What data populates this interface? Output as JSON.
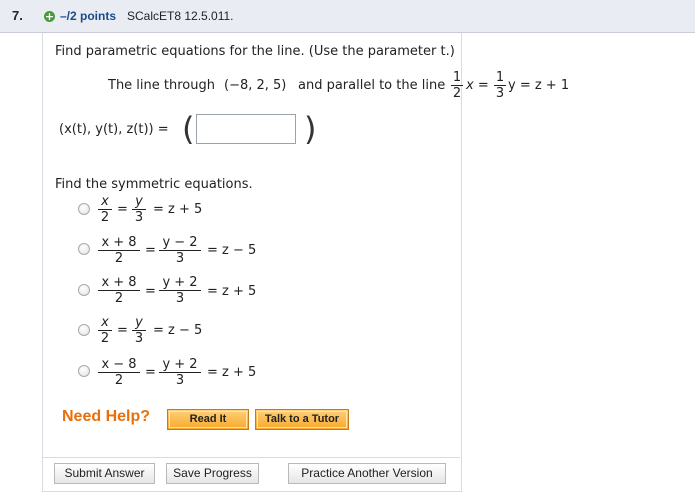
{
  "header": {
    "question_number": "7.",
    "points": "–/2 points",
    "question_id": "SCalcET8 12.5.011."
  },
  "prompt": {
    "instruction": "Find parametric equations for the line. (Use the parameter t.)",
    "line_prefix": "The line through",
    "point": "(−8, 2, 5)",
    "parallel_text": "and parallel to the line",
    "eq_frac1_num": "1",
    "eq_frac1_den": "2",
    "eq_x": "x =",
    "eq_frac2_num": "1",
    "eq_frac2_den": "3",
    "eq_y": "y = z + 1"
  },
  "parametric": {
    "label": "(x(t), y(t), z(t)) =",
    "value": ""
  },
  "symmetric": {
    "instruction": "Find the symmetric equations.",
    "options": [
      {
        "n1": "x",
        "d1": "2",
        "n2": "y",
        "d2": "3",
        "rhs": "= z + 5"
      },
      {
        "n1": "x + 8",
        "d1": "2",
        "n2": "y − 2",
        "d2": "3",
        "rhs": "= z − 5"
      },
      {
        "n1": "x + 8",
        "d1": "2",
        "n2": "y + 2",
        "d2": "3",
        "rhs": "= z + 5"
      },
      {
        "n1": "x",
        "d1": "2",
        "n2": "y",
        "d2": "3",
        "rhs": "= z − 5"
      },
      {
        "n1": "x − 8",
        "d1": "2",
        "n2": "y + 2",
        "d2": "3",
        "rhs": "= z + 5"
      }
    ]
  },
  "help": {
    "label": "Need Help?",
    "read_it": "Read It",
    "tutor": "Talk to a Tutor"
  },
  "actions": {
    "submit": "Submit Answer",
    "save": "Save Progress",
    "practice": "Practice Another Version"
  }
}
